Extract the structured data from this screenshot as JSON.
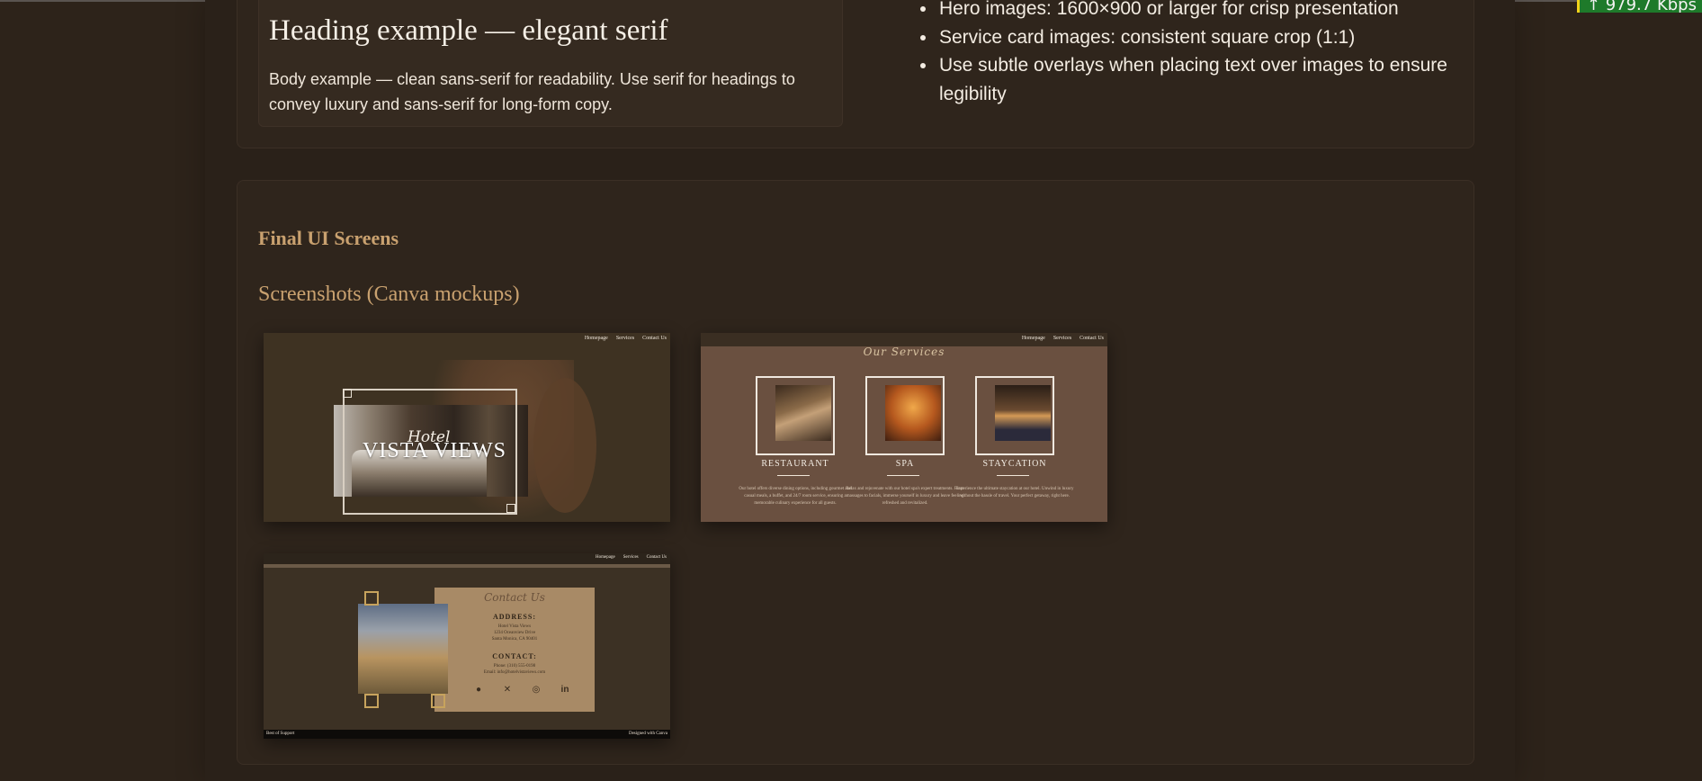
{
  "status": {
    "network_speed": "979.7 Kbps"
  },
  "typography_sample": {
    "heading": "Heading example — elegant serif",
    "body": "Body example — clean sans-serif for readability. Use serif for headings to convey luxury and sans-serif for long-form copy."
  },
  "image_guidelines": [
    "Hero images: 1600×900 or larger for crisp presentation",
    "Service card images: consistent square crop (1:1)",
    "Use subtle overlays when placing text over images to ensure legibility"
  ],
  "final_screens": {
    "title": "Final UI Screens",
    "subtitle": "Screenshots (Canva mockups)"
  },
  "mockup_nav": [
    "Homepage",
    "Services",
    "Contact Us"
  ],
  "mockup_home": {
    "script": "Hotel",
    "title": "VISTA VIEWS"
  },
  "mockup_services": {
    "title": "Our Services",
    "items": [
      {
        "label": "RESTAURANT",
        "desc": "Our hotel offers diverse dining options, including gourmet and casual meals, a buffet, and 24/7 room service, ensuring a memorable culinary experience for all guests."
      },
      {
        "label": "SPA",
        "desc": "Relax and rejuvenate with our hotel spa's expert treatments. From massages to facials, immerse yourself in luxury and leave feeling refreshed and revitalized."
      },
      {
        "label": "STAYCATION",
        "desc": "Experience the ultimate staycation at our hotel. Unwind in luxury without the hassle of travel. Your perfect getaway, right here."
      }
    ]
  },
  "mockup_contact": {
    "title": "Contact Us",
    "address_label": "ADDRESS:",
    "address_lines": [
      "Hotel Vista Views",
      "1234 Oceanview Drive",
      "Santa Monica, CA 90401"
    ],
    "contact_label": "CONTACT:",
    "contact_lines": [
      "Phone: (310) 555-0198",
      "Email: info@hotelvistaviews.com"
    ],
    "footer_left": "Best of Support",
    "footer_right": "Designed with Canva"
  },
  "colors": {
    "background": "#2d231a",
    "accent_gold": "#c9a16f",
    "card": "#2f251c"
  }
}
